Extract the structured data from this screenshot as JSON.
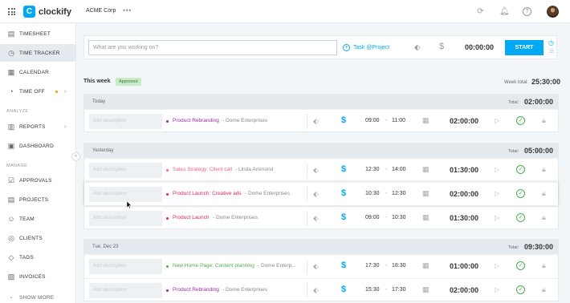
{
  "app": {
    "name": "clockify",
    "workspace": "ACME Corp",
    "more": "•••"
  },
  "topbar": {
    "icons": [
      "extension-icon",
      "bell-icon",
      "help-icon"
    ]
  },
  "sidebar": {
    "items": [
      {
        "label": "TIMESHEET",
        "icon": "timesheet-icon"
      },
      {
        "label": "TIME TRACKER",
        "icon": "clock-icon"
      },
      {
        "label": "CALENDAR",
        "icon": "calendar-icon"
      },
      {
        "label": "TIME OFF",
        "icon": "timeoff-icon"
      }
    ],
    "analyze_label": "ANALYZE",
    "analyze": [
      {
        "label": "REPORTS",
        "icon": "reports-icon"
      },
      {
        "label": "DASHBOARD",
        "icon": "dashboard-icon"
      }
    ],
    "manage_label": "MANAGE",
    "manage": [
      {
        "label": "APPROVALS",
        "icon": "approvals-icon"
      },
      {
        "label": "PROJECTS",
        "icon": "projects-icon"
      },
      {
        "label": "TEAM",
        "icon": "team-icon"
      },
      {
        "label": "CLIENTS",
        "icon": "clients-icon"
      },
      {
        "label": "TAGS",
        "icon": "tags-icon"
      },
      {
        "label": "INVOICES",
        "icon": "invoices-icon"
      }
    ],
    "show_more": "SHOW MORE"
  },
  "timer": {
    "placeholder": "What are you working on?",
    "task_label": "Task @Project",
    "duration": "00:00:00",
    "start_label": "START"
  },
  "week": {
    "label": "This week",
    "badge": "Approved",
    "total_label": "Week total:",
    "total": "25:30:00"
  },
  "days": [
    {
      "title": "Today",
      "total_label": "Total:",
      "total": "02:00:00",
      "entries": [
        {
          "desc": "Add description",
          "project": "Product Rebranding",
          "project_color": "#9c27b0",
          "client": "Dome Enterprises",
          "start": "09:00",
          "end": "11:00",
          "duration": "02:00:00"
        }
      ]
    },
    {
      "title": "Yesterday",
      "total_label": "Total:",
      "total": "05:00:00",
      "entries": [
        {
          "desc": "Add description",
          "project": "Sales Strategy: Client call",
          "project_color": "#f06292",
          "client": "Linda Ammond",
          "start": "12:30",
          "end": "14:00",
          "duration": "01:30:00"
        },
        {
          "desc": "Add description",
          "project": "Product Launch: Creative ads",
          "project_color": "#e91e63",
          "client": "Dome Enterprises",
          "start": "10:30",
          "end": "12:30",
          "duration": "02:00:00"
        },
        {
          "desc": "Add description",
          "project": "Product Launch",
          "project_color": "#e91e63",
          "client": "Dome Enterprises",
          "start": "09:00",
          "end": "10:30",
          "duration": "01:30:00"
        }
      ]
    },
    {
      "title": "Tue, Dec 23",
      "total_label": "Total:",
      "total": "09:30:00",
      "entries": [
        {
          "desc": "Add description",
          "project": "New Home Page: Content planning",
          "project_color": "#4caf50",
          "client": "Dome Enterp...",
          "start": "17:30",
          "end": "18:30",
          "duration": "01:00:00"
        },
        {
          "desc": "Add description",
          "project": "Product Rebranding",
          "project_color": "#9c27b0",
          "client": "Dome Enterprises",
          "start": "15:30",
          "end": "17:30",
          "duration": "02:00:00"
        }
      ]
    }
  ],
  "dash": "-",
  "dash_sep": "-",
  "colors": {
    "accent": "#03a9f4",
    "approved_bg": "#c9eac7",
    "approved_text": "#3c763d"
  }
}
